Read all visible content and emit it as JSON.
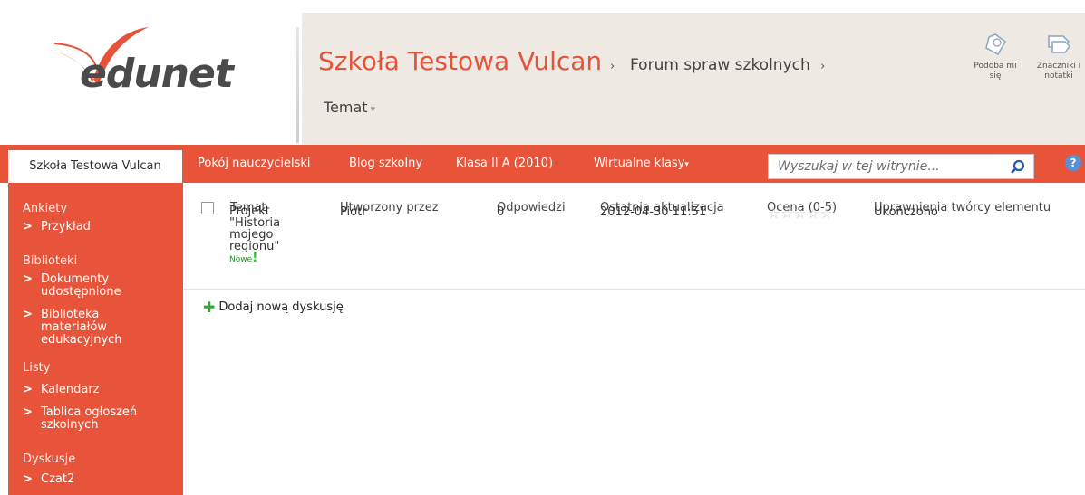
{
  "logo": {
    "text": "edunet"
  },
  "header": {
    "site_title": "Szkoła Testowa Vulcan",
    "breadcrumb_sep": "›",
    "breadcrumb_item": "Forum spraw szkolnych",
    "page_title": "Temat",
    "actions": [
      {
        "label": "Podoba mi się",
        "icon": "tag-like-icon"
      },
      {
        "label": "Znaczniki i notatki",
        "icon": "tags-notes-icon"
      }
    ]
  },
  "topnav": {
    "home": "Szkoła Testowa Vulcan",
    "items": [
      "Pokój nauczycielski",
      "Blog szkolny",
      "Klasa II A (2010)",
      "Wirtualne klasy"
    ],
    "search_placeholder": "Wyszukaj w tej witrynie...",
    "help": "?"
  },
  "sidebar": {
    "sections": [
      {
        "heading": "Ankiety",
        "items": [
          "Przykład"
        ]
      },
      {
        "heading": "Biblioteki",
        "items": [
          "Dokumenty udostępnione",
          "Biblioteka materiałów edukacyjnych"
        ]
      },
      {
        "heading": "Listy",
        "items": [
          "Kalendarz",
          "Tablica ogłoszeń szkolnych"
        ]
      },
      {
        "heading": "Dyskusje",
        "items": [
          "Czat2"
        ]
      }
    ],
    "arrow": ">"
  },
  "table": {
    "columns": [
      "Temat",
      "Utworzony przez",
      "Odpowiedzi",
      "Ostatnia aktualizacja",
      "Ocena (0-5)",
      "Uprawnienia twórcy elementu"
    ],
    "rows": [
      {
        "topic": "Projekt \"Historia mojego regionu\"",
        "new_label": "Nowe",
        "new_mark": "!",
        "author": "Piotr",
        "replies": "0",
        "updated": "2012-04-30 11:51",
        "rating": 0,
        "rating_max": 5,
        "status": "Ukończono"
      }
    ]
  },
  "add_discussion": "Dodaj nową dyskusję",
  "colors": {
    "accent": "#e8543a",
    "header_bg": "#eee9e2",
    "title": "#e5533a"
  }
}
